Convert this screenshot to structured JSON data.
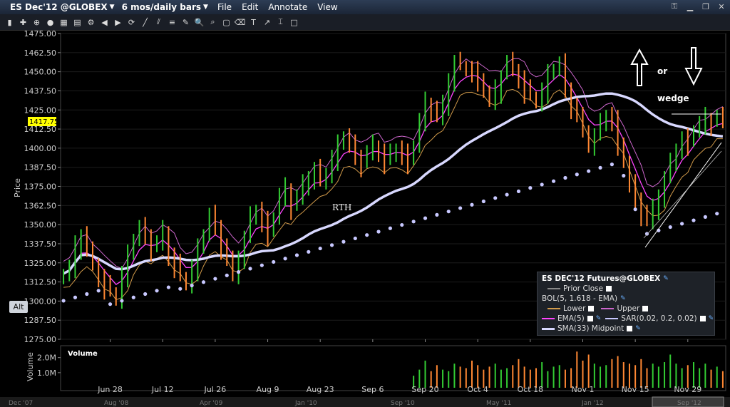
{
  "window": {
    "title": "ES Dec'12 @GLOBEX",
    "period": "6 mos/daily bars",
    "menu": [
      "File",
      "Edit",
      "Annotate",
      "View"
    ]
  },
  "colors": {
    "background": "#000000",
    "up_bar": "#33cc33",
    "down_bar": "#ff8833",
    "upper_band": "#cc66cc",
    "lower_band": "#d19a4a",
    "ema": "#ff44ff",
    "sar": "#c8c8ff",
    "sma": "#d8d8ff",
    "price_badge": "#ffff00"
  },
  "left_panel": {
    "price_label": "Price",
    "volume_label": "Volume",
    "alt_label": "Alt",
    "current_price": "1417.75"
  },
  "annotations": {
    "rth": "RTH",
    "or": "or",
    "wedge": "wedge"
  },
  "legend": {
    "title": "ES DEC'12 Futures@GLOBEX",
    "prior_close": "Prior Close",
    "bol": "BOL(5, 1.618 - EMA)",
    "lower": "Lower",
    "upper": "Upper",
    "ema": "EMA(5)",
    "sar": "SAR(0.02, 0.2, 0.02)",
    "sma": "SMA(33) Midpoint"
  },
  "chart_data": {
    "type": "line",
    "title": "ES Dec'12 @GLOBEX",
    "ylabel": "Price",
    "ylim": [
      1275,
      1475
    ],
    "y_ticks": [
      "1475.00",
      "1462.50",
      "1450.00",
      "1437.50",
      "1425.00",
      "1412.50",
      "1400.00",
      "1387.50",
      "1375.00",
      "1362.50",
      "1350.00",
      "1337.50",
      "1325.00",
      "1312.50",
      "1300.00",
      "1287.50",
      "1275.00"
    ],
    "x_ticks": [
      "Jun 28",
      "Jul 12",
      "Jul 26",
      "Aug 9",
      "Aug 23",
      "Sep 6",
      "Sep 20",
      "Oct 4",
      "Oct 18",
      "Nov 1",
      "Nov 15",
      "Nov 29"
    ],
    "navigator_labels": [
      "Dec '07",
      "Aug '08",
      "Apr '09",
      "Jan '10",
      "Sep '10",
      "May '11",
      "Jan '12",
      "Sep '12"
    ],
    "volume_ticks": [
      "2.0M",
      "1.0M"
    ],
    "volume_label": "Volume",
    "close": [
      1318,
      1322,
      1336,
      1344,
      1332,
      1325,
      1316,
      1310,
      1306,
      1302,
      1318,
      1330,
      1341,
      1348,
      1344,
      1335,
      1338,
      1346,
      1330,
      1324,
      1316,
      1312,
      1322,
      1334,
      1344,
      1356,
      1350,
      1336,
      1326,
      1318,
      1330,
      1341,
      1355,
      1360,
      1352,
      1345,
      1355,
      1369,
      1374,
      1362,
      1368,
      1376,
      1382,
      1386,
      1378,
      1384,
      1394,
      1402,
      1408,
      1402,
      1396,
      1390,
      1397,
      1402,
      1398,
      1392,
      1396,
      1400,
      1396,
      1392,
      1402,
      1418,
      1430,
      1426,
      1420,
      1428,
      1446,
      1456,
      1454,
      1452,
      1450,
      1446,
      1436,
      1432,
      1438,
      1448,
      1456,
      1452,
      1446,
      1438,
      1434,
      1431,
      1438,
      1448,
      1452,
      1455,
      1440,
      1428,
      1420,
      1412,
      1404,
      1408,
      1416,
      1422,
      1418,
      1404,
      1390,
      1376,
      1368,
      1358,
      1352,
      1360,
      1370,
      1380,
      1390,
      1400,
      1406,
      1404,
      1412,
      1416,
      1420,
      1417,
      1420,
      1418
    ],
    "volume": [
      0,
      0,
      0,
      0,
      0,
      0,
      0,
      0,
      0,
      0,
      0,
      0,
      0,
      0,
      0,
      0,
      0,
      0,
      0,
      0,
      0,
      0,
      0,
      0,
      0,
      0,
      0,
      0,
      0,
      0,
      0,
      0,
      0,
      0,
      0,
      0,
      0,
      0,
      0,
      0,
      0,
      0,
      0,
      0,
      0,
      0,
      0,
      0,
      0,
      0,
      0,
      0,
      0,
      0,
      0,
      0,
      0,
      0,
      0,
      0,
      0.8,
      1.2,
      1.8,
      1.1,
      1.5,
      1.2,
      1.1,
      1.6,
      1.4,
      1.3,
      1.8,
      1.5,
      1.2,
      1.4,
      1.6,
      1.2,
      1.3,
      1.5,
      1.9,
      1.4,
      1.2,
      1.3,
      1.7,
      1.1,
      1.4,
      1.5,
      1.2,
      1.3,
      2.4,
      1.8,
      2.2,
      1.6,
      1.4,
      1.5,
      1.9,
      2.1,
      1.7,
      1.6,
      1.5,
      1.9,
      1.3,
      1.6,
      1.4,
      1.7,
      2.2,
      1.6,
      1.3,
      1.5,
      1.7,
      1.3,
      1.6,
      1.2,
      1.4,
      1.1
    ]
  }
}
